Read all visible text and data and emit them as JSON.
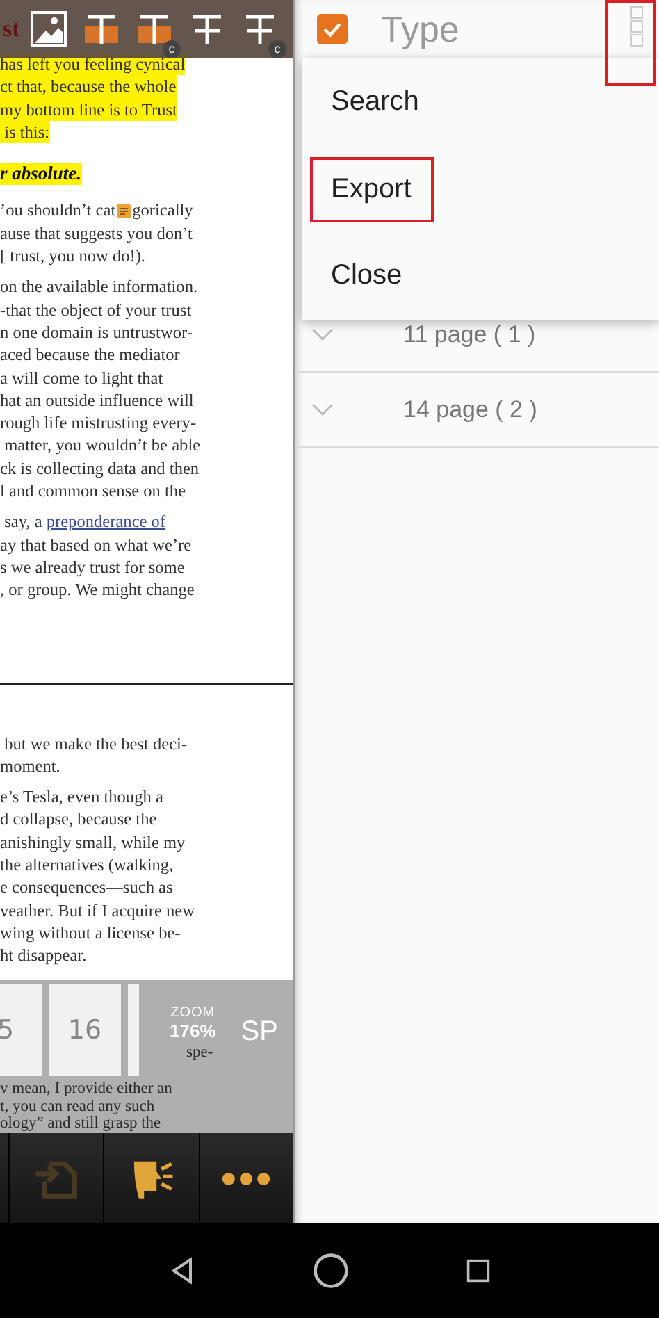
{
  "reader": {
    "heading_fragment": "st",
    "toolbar": [
      {
        "kind": "image"
      },
      {
        "kind": "highlight"
      },
      {
        "kind": "highlight",
        "badge": "c"
      },
      {
        "kind": "strikeout"
      },
      {
        "kind": "strikeout",
        "badge": "c"
      }
    ],
    "blocks": [
      {
        "kind": "para",
        "highlighted": true,
        "lines": [
          {
            "text": "has left you feeling cynical"
          },
          {
            "text": "ct that, because the whole"
          },
          {
            "text": "my bottom line is to Trust"
          },
          {
            "text": " is this:"
          }
        ]
      },
      {
        "kind": "heading",
        "highlighted": true,
        "lines": [
          {
            "text": "r absolute."
          }
        ]
      },
      {
        "kind": "para",
        "highlighted": false,
        "lines": [
          {
            "text": "’ou shouldn’t cat",
            "after_note": "gorically"
          },
          {
            "text": "ause that suggests you don’t"
          },
          {
            "text": "[ trust, you now do!)."
          }
        ]
      },
      {
        "kind": "para",
        "highlighted": false,
        "lines": [
          {
            "text": "on the available information."
          },
          {
            "text": "-that the object of your trust"
          },
          {
            "text": "n one domain is untrustwor-"
          },
          {
            "text": "aced because the mediator"
          },
          {
            "text": "a will come to light that"
          },
          {
            "text": "hat an outside influence will"
          },
          {
            "text": "rough life mistrusting every-"
          },
          {
            "text": " matter, you wouldn’t be able"
          },
          {
            "text": "ck is collecting data and then"
          },
          {
            "text": "l and common sense on the"
          }
        ]
      },
      {
        "kind": "para",
        "highlighted": false,
        "lines": [
          {
            "text": " say, a ",
            "link": "preponderance of"
          },
          {
            "text": "ay that based on what we’re"
          },
          {
            "text": "s we already trust for some"
          },
          {
            "text": ", or group. We might change"
          }
        ]
      },
      {
        "kind": "page-break"
      },
      {
        "kind": "para",
        "highlighted": false,
        "lines": [
          {
            "text": " but we make the best deci-"
          },
          {
            "text": "moment."
          }
        ]
      },
      {
        "kind": "para",
        "highlighted": false,
        "lines": [
          {
            "text": "e’s Tesla, even though a"
          },
          {
            "text": "d collapse, because the"
          },
          {
            "text": "anishingly small, while my"
          },
          {
            "text": "the alternatives (walking,"
          },
          {
            "text": "e consequences—such as"
          },
          {
            "text": "veather. But if I acquire new"
          },
          {
            "text": "wing without a license be-"
          },
          {
            "text": "ht disappear."
          }
        ]
      }
    ],
    "under_strip": {
      "aside": "spe-",
      "lines": [
        "v mean, I provide either an",
        "t, you can read any such",
        "ology” and still grasp the"
      ]
    },
    "thumbnails": [
      {
        "label": "5"
      },
      {
        "label": "16"
      }
    ],
    "zoom": {
      "label": "ZOOM",
      "value": "176%"
    },
    "mode": "SP",
    "actions": [
      {
        "kind": "export",
        "disabled": true
      },
      {
        "kind": "speak",
        "disabled": false
      },
      {
        "kind": "more",
        "disabled": false
      }
    ]
  },
  "panel": {
    "select_all": {
      "checked": true
    },
    "title": "Type",
    "overflow_annotated": true,
    "menu": [
      {
        "label": "Search",
        "annotated": false
      },
      {
        "label": "Export",
        "annotated": true
      },
      {
        "label": "Close",
        "annotated": false
      }
    ],
    "rows": [
      {
        "label": "11 page ( 1 )",
        "expanded": false
      },
      {
        "label": "14 page ( 2 )",
        "expanded": false
      }
    ]
  },
  "nav": [
    {
      "kind": "back"
    },
    {
      "kind": "home"
    },
    {
      "kind": "recent"
    }
  ]
}
